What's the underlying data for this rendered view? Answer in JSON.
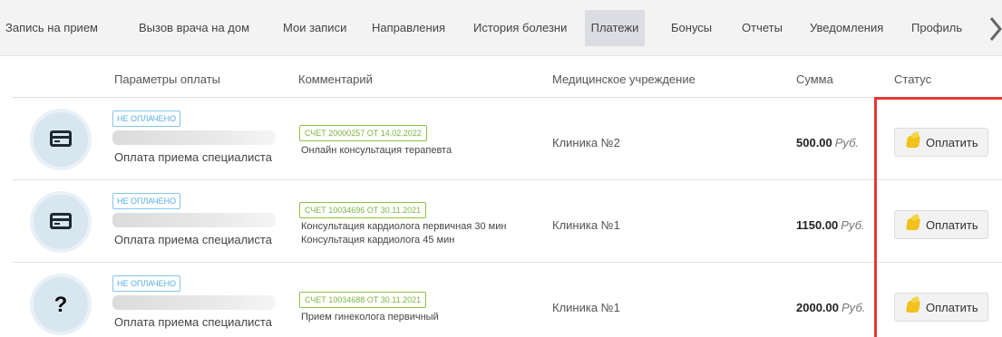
{
  "tabs": [
    {
      "label": "Запись на прием"
    },
    {
      "label": "Вызов врача на дом"
    },
    {
      "label": "Мои записи"
    },
    {
      "label": "Направления"
    },
    {
      "label": "История болезни"
    },
    {
      "label": "Платежи",
      "active": true
    },
    {
      "label": "Бонусы"
    },
    {
      "label": "Отчеты"
    },
    {
      "label": "Уведомления"
    },
    {
      "label": "Профиль"
    }
  ],
  "columns": {
    "params": "Параметры оплаты",
    "comment": "Комментарий",
    "clinic": "Медицинское учреждение",
    "amount": "Сумма",
    "status": "Статус"
  },
  "payments": [
    {
      "icon": "credit-card-icon",
      "status_badge": "НЕ ОПЛАЧЕНО",
      "description": "Оплата приема специалиста",
      "invoice": "СЧЕТ 20000257 ОТ 14.02.2022",
      "comment_lines": [
        "Онлайн консультация терапевта"
      ],
      "clinic": "Клиника №2",
      "amount": "500.00",
      "currency": "Руб.",
      "action": "Оплатить"
    },
    {
      "icon": "credit-card-icon",
      "status_badge": "НЕ ОПЛАЧЕНО",
      "description": "Оплата приема специалиста",
      "invoice": "СЧЕТ 10034696 ОТ 30.11.2021",
      "comment_lines": [
        "Консультация кардиолога первичная 30 мин",
        "Консультация кардиолога 45 мин"
      ],
      "clinic": "Клиника №1",
      "amount": "1150.00",
      "currency": "Руб.",
      "action": "Оплатить"
    },
    {
      "icon": "question-icon",
      "status_badge": "НЕ ОПЛАЧЕНО",
      "description": "Оплата приема специалиста",
      "invoice": "СЧЕТ 10034688 ОТ 30.11.2021",
      "comment_lines": [
        "Прием гинеколога первичный"
      ],
      "clinic": "Клиника №1",
      "amount": "2000.00",
      "currency": "Руб.",
      "action": "Оплатить"
    }
  ],
  "icons": {
    "tabs_next": "chevron-right-icon",
    "pay": "wallet-icon",
    "unknown": "?"
  },
  "colors": {
    "unpaid_badge": "#5aaee8",
    "invoice_badge": "#7cb342",
    "highlight": "#e53935",
    "active_tab": "#dcdde2"
  }
}
